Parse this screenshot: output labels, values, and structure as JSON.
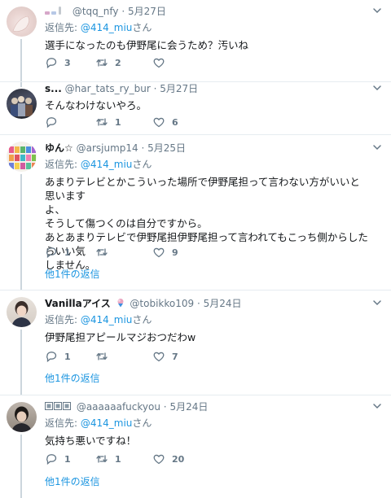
{
  "tweets": [
    {
      "name": "",
      "handle": "@tqq_nfy",
      "dot": "·",
      "time": "5月27日",
      "reply_label": "返信先:",
      "reply_mention": "@414_miu",
      "reply_suffix": "さん",
      "text": "選手になったのも伊野尾に会うため？汚いね",
      "reply_count": "3",
      "retweet_count": "2",
      "like_count": ""
    },
    {
      "name": "s...",
      "handle": "@har_tats_ry_bur",
      "dot": "·",
      "time": "5月27日",
      "text": "そんなわけないやろ。",
      "reply_count": "",
      "retweet_count": "1",
      "like_count": "6"
    },
    {
      "name": "ゆん☆",
      "handle": "@arsjump14",
      "dot": "·",
      "time": "5月25日",
      "reply_label": "返信先:",
      "reply_mention": "@414_miu",
      "reply_suffix": "さん",
      "text": "あまりテレビとかこういった場所で伊野尾担って言わない方がいいと思います\nよ、\nそうして傷つくのは自分ですから。\nあとあまりテレビで伊野尾担伊野尾担って言われてもこっち側からしたらいい気\nしません。",
      "reply_count": "1",
      "retweet_count": "",
      "like_count": "9",
      "more": "他1件の返信"
    },
    {
      "name": "Vanillaアイス",
      "handle": "@tobikko109",
      "dot": "·",
      "time": "5月24日",
      "reply_label": "返信先:",
      "reply_mention": "@414_miu",
      "reply_suffix": "さん",
      "text": "伊野尾担アピールマジおつだわw",
      "reply_count": "1",
      "retweet_count": "",
      "like_count": "7",
      "more": "他1件の返信"
    },
    {
      "name": "",
      "handle": "@aaaaaafuckyou",
      "dot": "·",
      "time": "5月24日",
      "reply_label": "返信先:",
      "reply_mention": "@414_miu",
      "reply_suffix": "さん",
      "text": "気持ち悪いですね！",
      "reply_count": "1",
      "retweet_count": "1",
      "like_count": "20",
      "more": "他1件の返信"
    }
  ],
  "colors": {
    "link": "#1b95e0",
    "muted": "#657786",
    "separator": "#e6ecf0",
    "thread": "#ccd6dd"
  },
  "icons": [
    "reply-icon",
    "retweet-icon",
    "like-icon",
    "caret-down-icon"
  ]
}
